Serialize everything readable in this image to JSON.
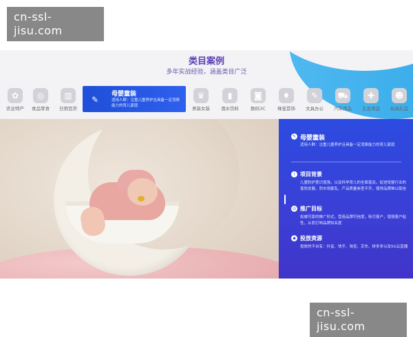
{
  "watermark": {
    "text": "cn-ssl-jisu.com"
  },
  "header": {
    "title": "类目案例",
    "subtitle": "多年实战经验，涵盖类目广泛"
  },
  "categories": [
    {
      "label": "农业特产",
      "icon": "flower-icon"
    },
    {
      "label": "食品零食",
      "icon": "lollipop-icon"
    },
    {
      "label": "日用百货",
      "icon": "household-icon"
    },
    {
      "label": "母婴童装",
      "icon": "baby-bottle-icon",
      "active": true,
      "desc": "适用人群：注重儿童养护且具备一定消费能力的育儿家庭"
    },
    {
      "label": "男装女装",
      "icon": "shirt-icon"
    },
    {
      "label": "酒水饮料",
      "icon": "bottle-icon"
    },
    {
      "label": "数码3C",
      "icon": "camera-icon"
    },
    {
      "label": "珠宝首饰",
      "icon": "jewelry-icon"
    },
    {
      "label": "文具办公",
      "icon": "stationery-icon"
    },
    {
      "label": "汽车用品",
      "icon": "car-icon"
    },
    {
      "label": "五金用品",
      "icon": "wrench-icon"
    },
    {
      "label": "玩具礼品",
      "icon": "teddy-bear-icon"
    }
  ],
  "detail": {
    "title": "母婴童装",
    "desc": "适用人群：注重儿童养护且具备一定消费能力的育儿家庭",
    "sections": [
      {
        "title": "项目背景",
        "body": "儿童防护意识增强，以及科学育儿的全面普及，促进母婴行业的蓬勃发展，而市场繁乱，产品质量参差不齐，使得品牌难以取信"
      },
      {
        "title": "推广目标",
        "body": "权威可靠的推广形式，营造品牌可信度，吸引客户，增强客户粘性，从而打响品牌知名度"
      },
      {
        "title": "投放资源",
        "body": "投放的平台有：抖音、快手、淘宝、京东、拼多多以及5G云直播"
      }
    ]
  },
  "colors": {
    "accent": "#2c4be0",
    "title": "#5b3db5",
    "wave": "#4fb8f0"
  }
}
